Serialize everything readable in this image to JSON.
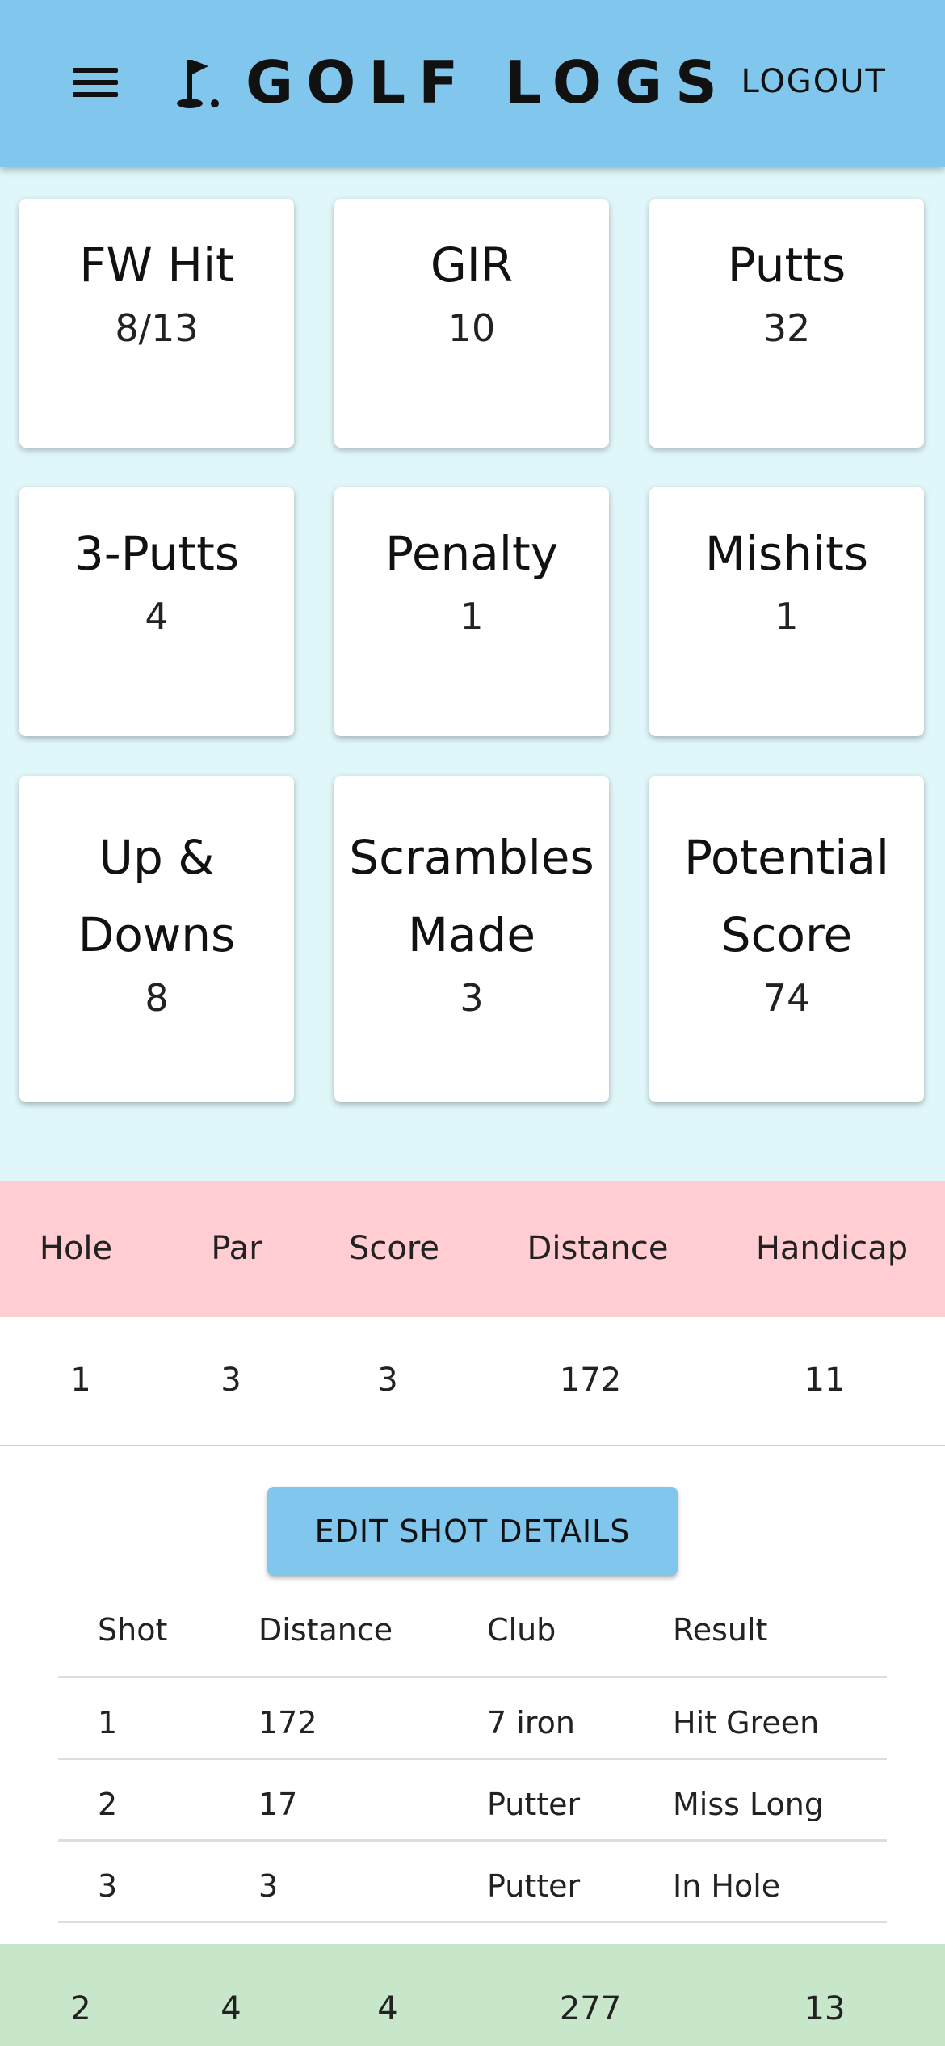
{
  "appbar": {
    "title": "GOLF LOGS",
    "logout_label": "LOGOUT"
  },
  "stats": [
    {
      "label": "FW Hit",
      "value": "8/13"
    },
    {
      "label": "GIR",
      "value": "10"
    },
    {
      "label": "Putts",
      "value": "32"
    },
    {
      "label": "3-Putts",
      "value": "4"
    },
    {
      "label": "Penalty",
      "value": "1"
    },
    {
      "label": "Mishits",
      "value": "1"
    },
    {
      "label": "Up & Downs",
      "value": "8"
    },
    {
      "label": "Scrambles Made",
      "value": "3"
    },
    {
      "label": "Potential Score",
      "value": "74"
    }
  ],
  "holes_table": {
    "headers": [
      "Hole",
      "Par",
      "Score",
      "Distance",
      "Handicap"
    ],
    "rows": [
      {
        "hole": "1",
        "par": "3",
        "score": "3",
        "distance": "172",
        "handicap": "11"
      },
      {
        "hole": "2",
        "par": "4",
        "score": "4",
        "distance": "277",
        "handicap": "13"
      }
    ]
  },
  "shot_details": {
    "edit_button_label": "EDIT SHOT DETAILS",
    "headers": [
      "Shot",
      "Distance",
      "Club",
      "Result"
    ],
    "rows": [
      {
        "shot": "1",
        "distance": "172",
        "club": "7 iron",
        "result": "Hit Green"
      },
      {
        "shot": "2",
        "distance": "17",
        "club": "Putter",
        "result": "Miss Long"
      },
      {
        "shot": "3",
        "distance": "3",
        "club": "Putter",
        "result": "In Hole"
      }
    ]
  },
  "colors": {
    "appbar": "#81c6ec",
    "background": "#e0f7fa",
    "table_header": "#ffcdd2",
    "next_hole_row": "#c8e6c9",
    "edit_button": "#81c6ec"
  },
  "icons": {
    "menu": "hamburger-menu-icon",
    "logo": "golf-flag-icon"
  }
}
